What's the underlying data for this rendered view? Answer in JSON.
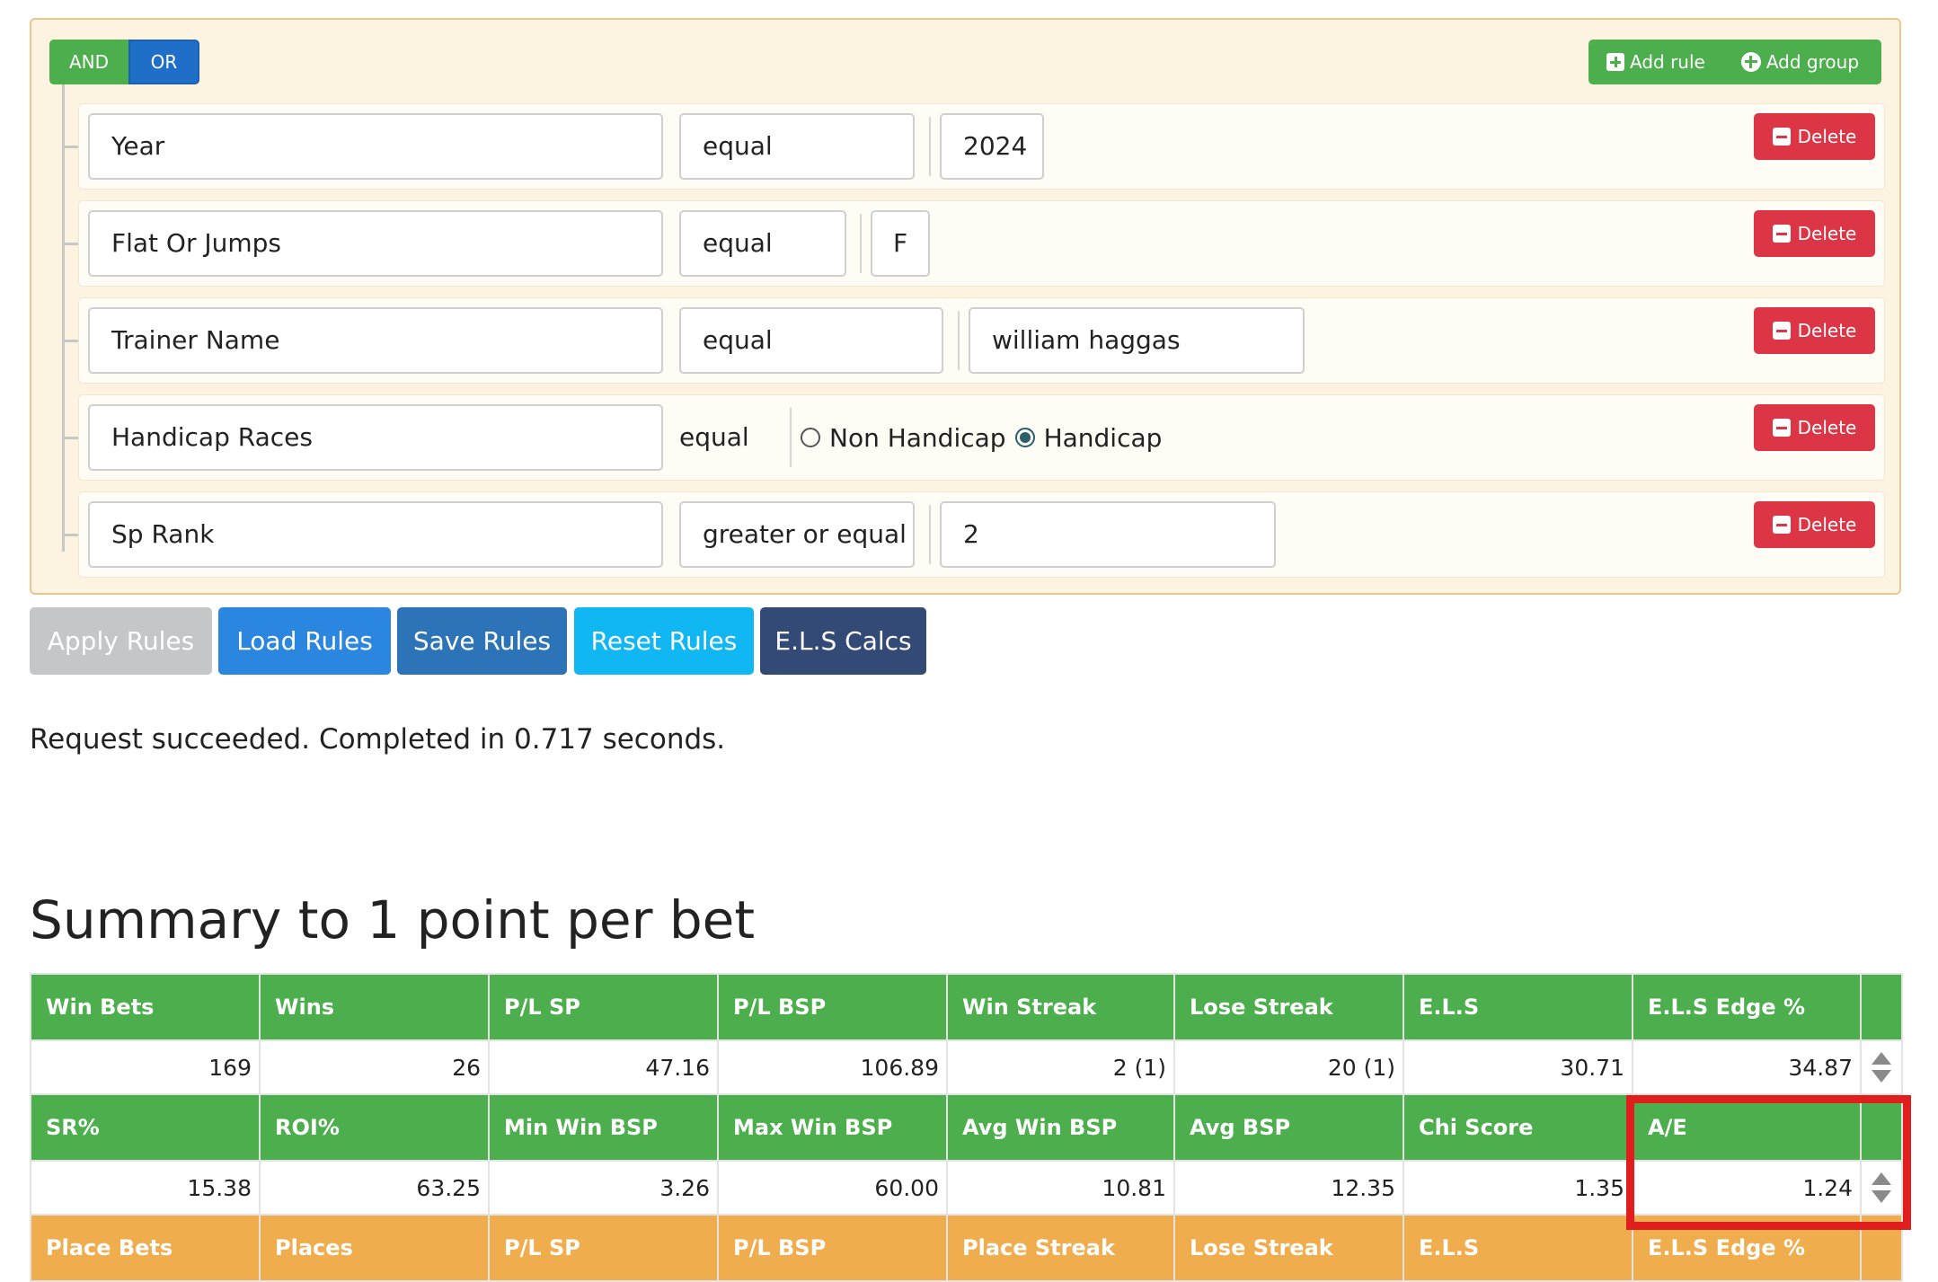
{
  "query_builder": {
    "conditions": {
      "and_label": "AND",
      "or_label": "OR",
      "active": "OR"
    },
    "add_rule_label": "Add rule",
    "add_group_label": "Add group",
    "delete_label": "Delete",
    "rules": [
      {
        "field": "Year",
        "operator": "equal",
        "value": "2024"
      },
      {
        "field": "Flat Or Jumps",
        "operator": "equal",
        "value": "F"
      },
      {
        "field": "Trainer Name",
        "operator": "equal",
        "value": "william haggas"
      },
      {
        "field": "Handicap Races",
        "operator": "equal",
        "options": [
          "Non Handicap",
          "Handicap"
        ],
        "selected": "Handicap"
      },
      {
        "field": "Sp Rank",
        "operator": "greater or equal",
        "value": "2"
      }
    ]
  },
  "actions": {
    "apply": "Apply Rules",
    "load": "Load Rules",
    "save": "Save Rules",
    "reset": "Reset Rules",
    "els": "E.L.S Calcs"
  },
  "colors": {
    "apply": "#c4c6c8",
    "load": "#2b86e0",
    "save": "#2c73b8",
    "reset": "#10b7f2",
    "els": "#344a76",
    "green_header": "#4cae4c",
    "orange_header": "#f0ad4e",
    "delete": "#dc3545",
    "highlight": "#e01e1e"
  },
  "status": "Request succeeded. Completed in 0.717 seconds.",
  "summary": {
    "title": "Summary to 1 point per bet",
    "row1": {
      "headers": [
        "Win Bets",
        "Wins",
        "P/L SP",
        "P/L BSP",
        "Win Streak",
        "Lose Streak",
        "E.L.S",
        "E.L.S Edge %"
      ],
      "values": [
        "169",
        "26",
        "47.16",
        "106.89",
        "2 (1)",
        "20 (1)",
        "30.71",
        "34.87"
      ]
    },
    "row2": {
      "headers": [
        "SR%",
        "ROI%",
        "Min Win BSP",
        "Max Win BSP",
        "Avg Win BSP",
        "Avg BSP",
        "Chi Score",
        "A/E"
      ],
      "values": [
        "15.38",
        "63.25",
        "3.26",
        "60.00",
        "10.81",
        "12.35",
        "1.35",
        "1.24"
      ]
    },
    "row3": {
      "headers": [
        "Place Bets",
        "Places",
        "P/L SP",
        "P/L BSP",
        "Place Streak",
        "Lose Streak",
        "E.L.S",
        "E.L.S Edge %"
      ]
    }
  }
}
